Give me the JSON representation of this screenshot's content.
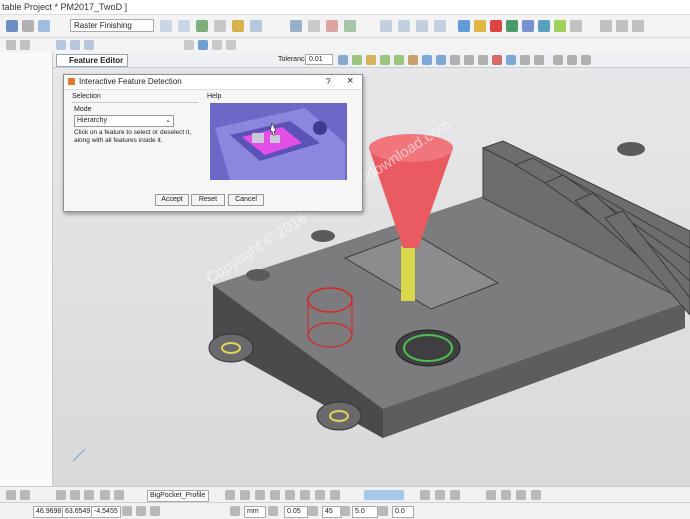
{
  "window": {
    "title": "table Project * PM2017_TwoD ]"
  },
  "toolbar": {
    "strategy_combo": "Raster Finishing",
    "tolerance_label": "Tolerance",
    "tolerance_value": "0.01",
    "accent_color": "#3b7fd4"
  },
  "feature_editor": {
    "tab_label": "Feature Editor"
  },
  "dialog": {
    "title": "Interactive Feature Detection",
    "help_glyph": "?",
    "close_glyph": "×",
    "selection_label": "Selection",
    "help_label": "Help",
    "mode_label": "Mode",
    "mode_value": "Hierarchy",
    "description": "Click on a feature to select or deselect it, along with all features inside it.",
    "accept_label": "Accept",
    "reset_label": "Reset",
    "cancel_label": "Cancel"
  },
  "watermark": {
    "text": "Copyright © 2016 - www.p30download.com"
  },
  "statusbar": {
    "toolpath_name": "BigPocket_Profile",
    "x": "46.9698",
    "y": "63.6549",
    "z": "-4.5455",
    "units": "mm",
    "step_value": "0.05",
    "angle_value": "45",
    "size_value": "5.0",
    "last_value": "0.0"
  }
}
